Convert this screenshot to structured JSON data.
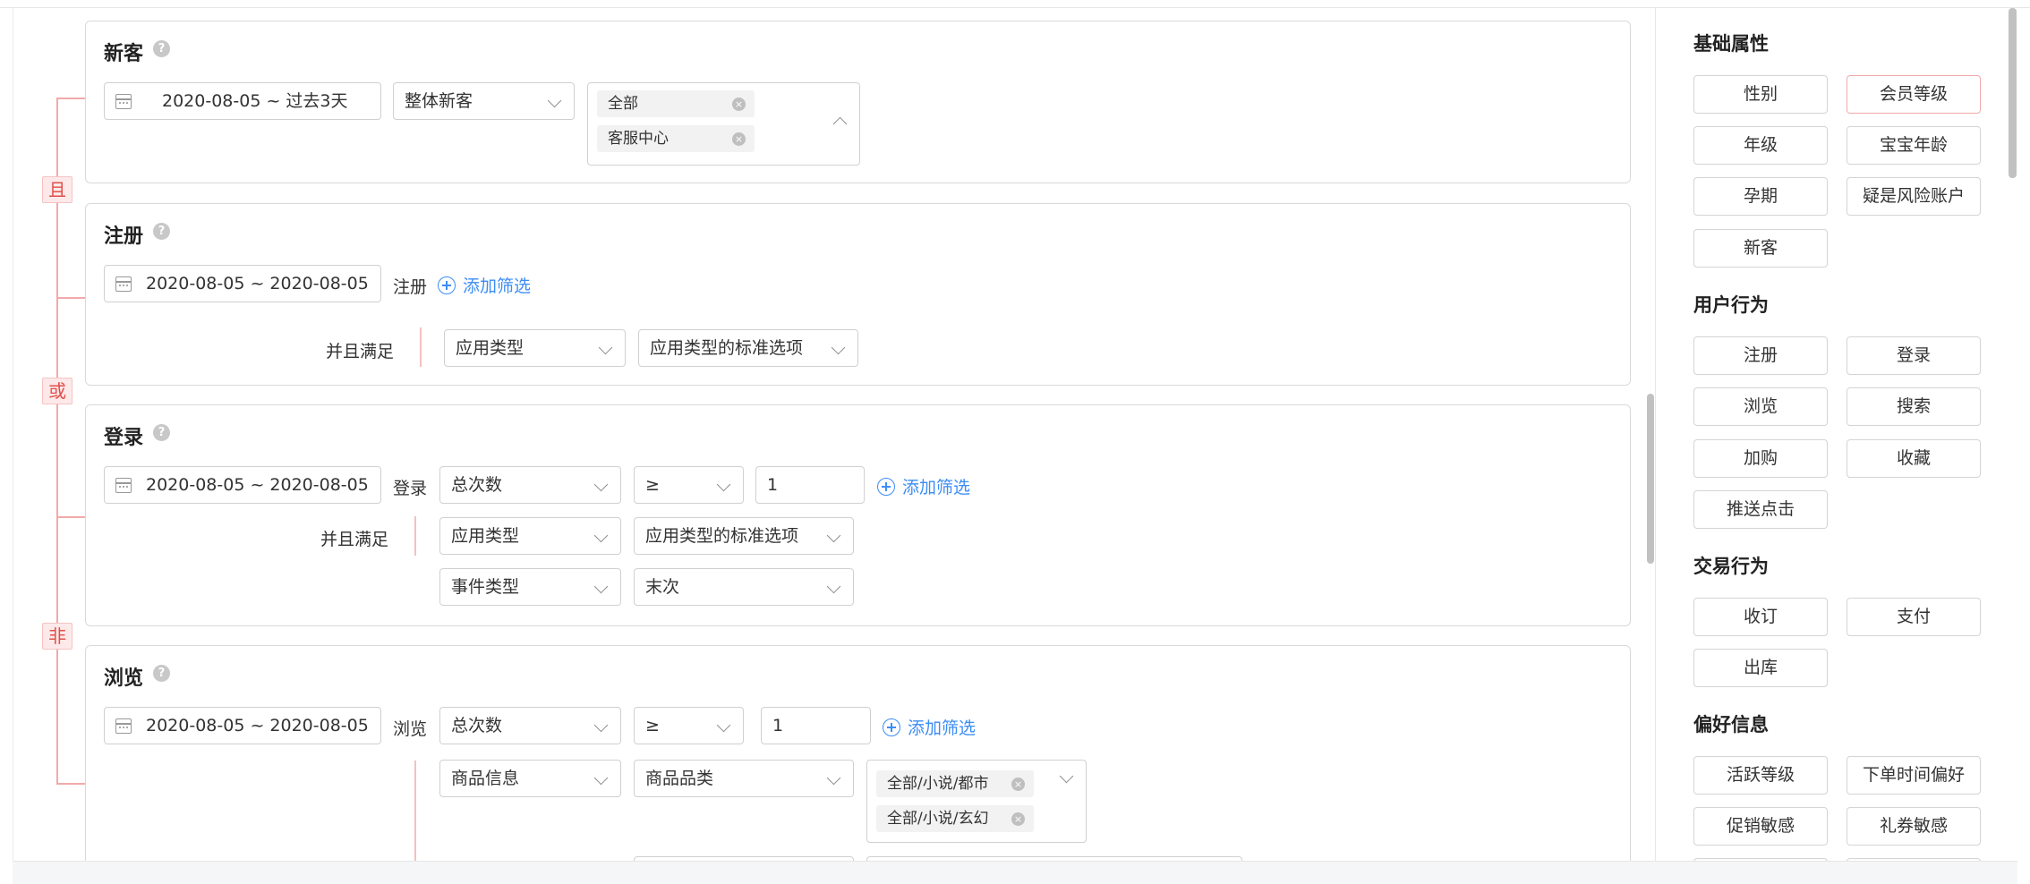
{
  "logic": {
    "and": "且",
    "or": "或",
    "not": "非"
  },
  "cards": {
    "newcust": {
      "title": "新客",
      "date_range": "2020-08-05  ~  过去3天",
      "type": "整体新客",
      "tags": [
        "全部",
        "客服中心"
      ]
    },
    "register": {
      "title": "注册",
      "date_range": "2020-08-05  ~  2020-08-05",
      "event": "注册",
      "add_filter": "添加筛选",
      "and_satisfy": "并且满足",
      "cond_field": "应用类型",
      "cond_value": "应用类型的标准选项"
    },
    "login": {
      "title": "登录",
      "date_range": "2020-08-05  ~  2020-08-05",
      "event": "登录",
      "metric": "总次数",
      "operator": "≥",
      "value": "1",
      "add_filter": "添加筛选",
      "and_satisfy": "并且满足",
      "cond1_field": "应用类型",
      "cond1_value": "应用类型的标准选项",
      "cond2_field": "事件类型",
      "cond2_value": "末次"
    },
    "browse": {
      "title": "浏览",
      "date_range": "2020-08-05  ~  2020-08-05",
      "event": "浏览",
      "metric": "总次数",
      "operator": "≥",
      "value": "1",
      "add_filter": "添加筛选",
      "cond_field": "商品信息",
      "cond_sub": "商品品类",
      "tags": [
        "全部/小说/都市",
        "全部/小说/玄幻"
      ]
    }
  },
  "panel": {
    "basic": {
      "title": "基础属性",
      "items": [
        "性别",
        "会员等级",
        "年级",
        "宝宝年龄",
        "孕期",
        "疑是风险账户",
        "新客"
      ]
    },
    "behavior": {
      "title": "用户行为",
      "items": [
        "注册",
        "登录",
        "浏览",
        "搜索",
        "加购",
        "收藏",
        "推送点击"
      ]
    },
    "trade": {
      "title": "交易行为",
      "items": [
        "收订",
        "支付",
        "出库"
      ]
    },
    "pref": {
      "title": "偏好信息",
      "items": [
        "活跃等级",
        "下单时间偏好",
        "促销敏感",
        "礼券敏感"
      ]
    }
  }
}
